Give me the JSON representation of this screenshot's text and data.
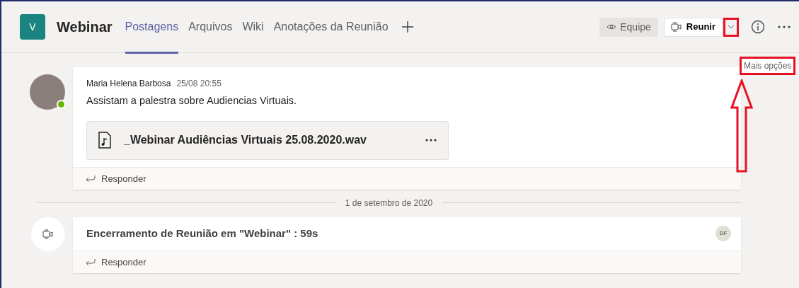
{
  "header": {
    "team_initial": "V",
    "title": "Webinar",
    "tabs": [
      {
        "label": "Postagens",
        "selected": true
      },
      {
        "label": "Arquivos",
        "selected": false
      },
      {
        "label": "Wiki",
        "selected": false
      },
      {
        "label": "Anotações da Reunião",
        "selected": false
      }
    ],
    "team_button": "Equipe",
    "meet_button": "Reunir",
    "tooltip": "Mais opções"
  },
  "feed": [
    {
      "kind": "post",
      "author": "Maria Helena Barbosa",
      "time": "25/08 20:55",
      "text": "Assistam a palestra sobre Audiencias Virtuais.",
      "online": true,
      "attachment": "_Webinar Audiências Virtuais 25.08.2020.wav",
      "reply": "Responder"
    },
    {
      "kind": "date",
      "text": "1 de setembro de 2020"
    },
    {
      "kind": "meeting",
      "text": "Encerramento de Reunião em \"Webinar\" : 59s",
      "badge": "DF",
      "reply": "Responder"
    }
  ]
}
